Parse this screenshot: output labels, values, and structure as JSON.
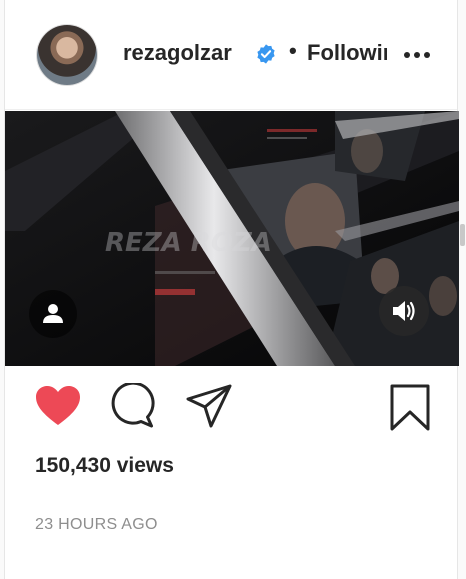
{
  "header": {
    "username": "rezagolzar",
    "verified_icon": "verified-badge-icon",
    "separator": "•",
    "follow_label": "Following",
    "more_icon": "more-options-icon"
  },
  "media": {
    "type": "video",
    "user_tag_icon": "user-tag-icon",
    "sound_icon": "speaker-volume-icon"
  },
  "actions": {
    "like_icon": "heart-icon",
    "like_color": "#ed4956",
    "comment_icon": "comment-icon",
    "share_icon": "paper-plane-icon",
    "save_icon": "bookmark-icon"
  },
  "stats": {
    "views": "150,430 views"
  },
  "timestamp": "23 HOURS AGO"
}
